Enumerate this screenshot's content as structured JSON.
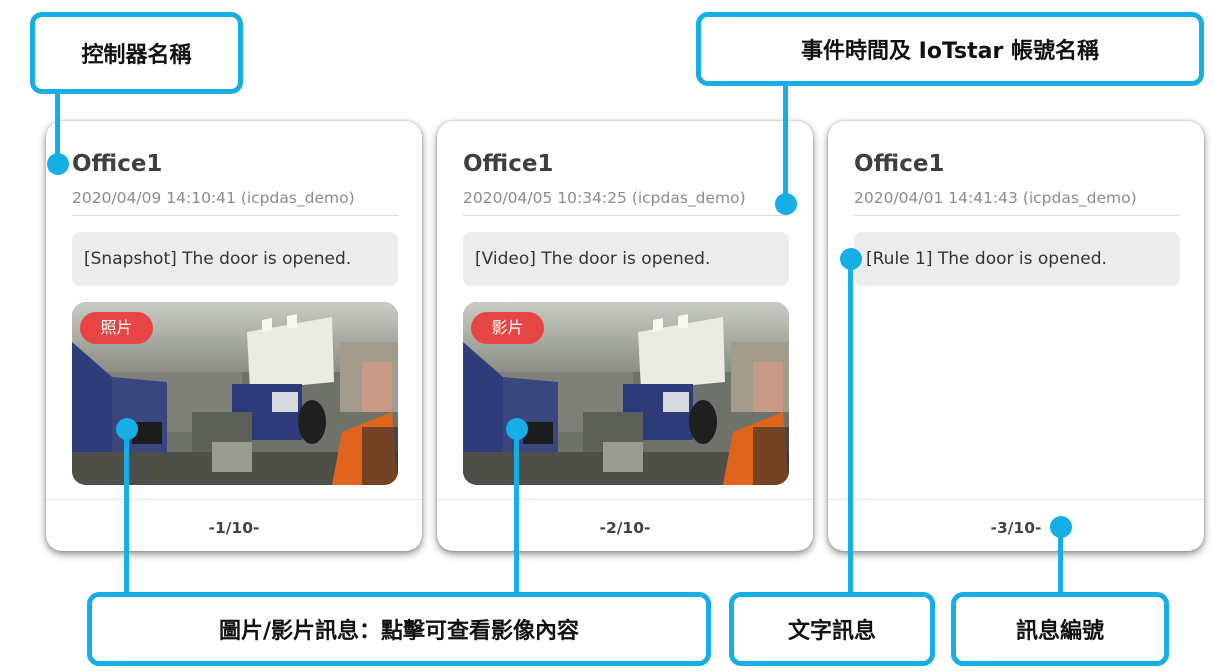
{
  "cards": [
    {
      "controller": "Office1",
      "time": "2020/04/09 14:10:41 (icpdas_demo)",
      "message": "[Snapshot] The door is opened.",
      "badge": "照片",
      "page": "-1/10-"
    },
    {
      "controller": "Office1",
      "time": "2020/04/05 10:34:25 (icpdas_demo)",
      "message": "[Video] The door is opened.",
      "badge": "影片",
      "page": "-2/10-"
    },
    {
      "controller": "Office1",
      "time": "2020/04/01 14:41:43 (icpdas_demo)",
      "message": "[Rule 1] The door is opened.",
      "page": "-3/10-"
    }
  ],
  "callouts": {
    "controller_name": "控制器名稱",
    "event_time": "事件時間及 IoTstar 帳號名稱",
    "media_message": "圖片/影片訊息：點擊可查看影像內容",
    "text_message": "文字訊息",
    "message_number": "訊息編號"
  },
  "colors": {
    "accent": "#16aee6",
    "badge": "#e84545"
  }
}
